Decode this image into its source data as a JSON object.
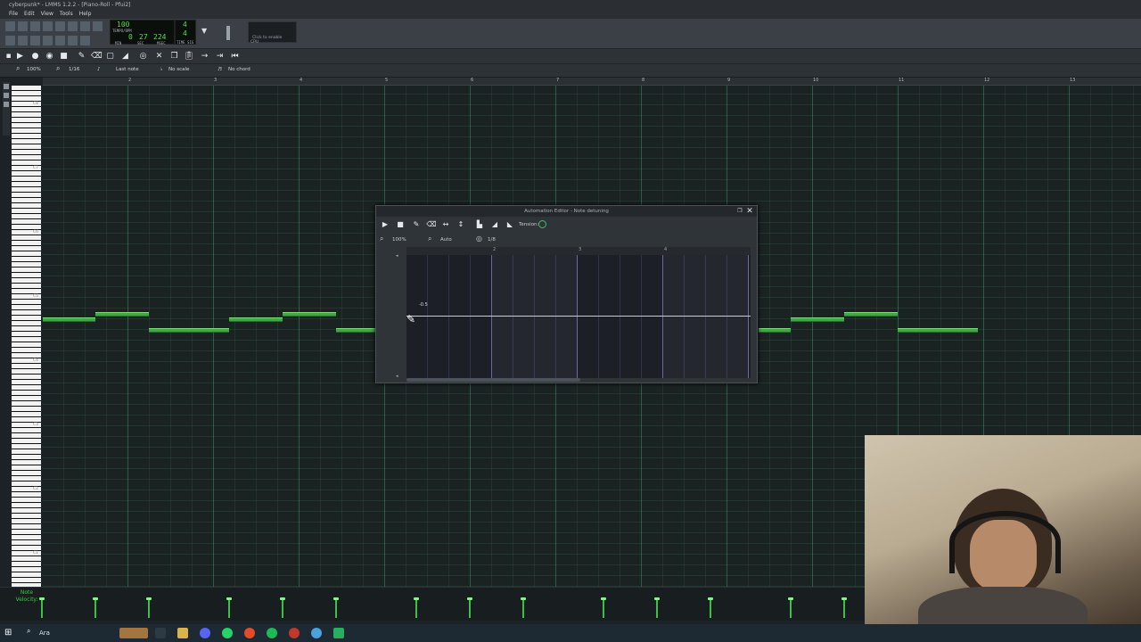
{
  "window": {
    "title": "cyberpunk* - LMMS 1.2.2 - [Piano-Roll - Pfui2]"
  },
  "menu": [
    "File",
    "Edit",
    "View",
    "Tools",
    "Help"
  ],
  "transport": {
    "tempo": "100",
    "tempo_label": "TEMPO/BPM",
    "time_min": "0",
    "time_sec": "27",
    "time_msec": "224",
    "min_label": "MIN",
    "sec_label": "SEC",
    "msec_label": "MSEC",
    "timesig_num": "4",
    "timesig_den": "4",
    "timesig_label": "TIME SIG",
    "cpu_hint": "Click to enable",
    "cpu_label": "CPU"
  },
  "piano_roll": {
    "zoom": "100%",
    "quantize": "1/16",
    "note_length": "Last note",
    "scale": "No scale",
    "chord": "No chord",
    "ruler_ticks": [
      "2",
      "3",
      "4",
      "5",
      "6",
      "7",
      "8",
      "9",
      "10",
      "11",
      "12",
      "13"
    ],
    "octaves": [
      "C8",
      "C7",
      "C6",
      "C5",
      "C4",
      "C3",
      "C2",
      "C1"
    ],
    "velocity_label": "Note Velocity:"
  },
  "automation_editor": {
    "title": "Automation Editor - Note detuning",
    "tension_label": "Tension:",
    "zoom": "100%",
    "zoom_y": "Auto",
    "quantize": "1/8",
    "ruler_ticks": [
      "2",
      "3",
      "4"
    ],
    "value_label": "-0.5"
  },
  "taskbar": {
    "search_placeholder": "Ara"
  },
  "colors": {
    "note": "#3fa845",
    "grid": "#1b2322",
    "accent": "#42c24a"
  }
}
